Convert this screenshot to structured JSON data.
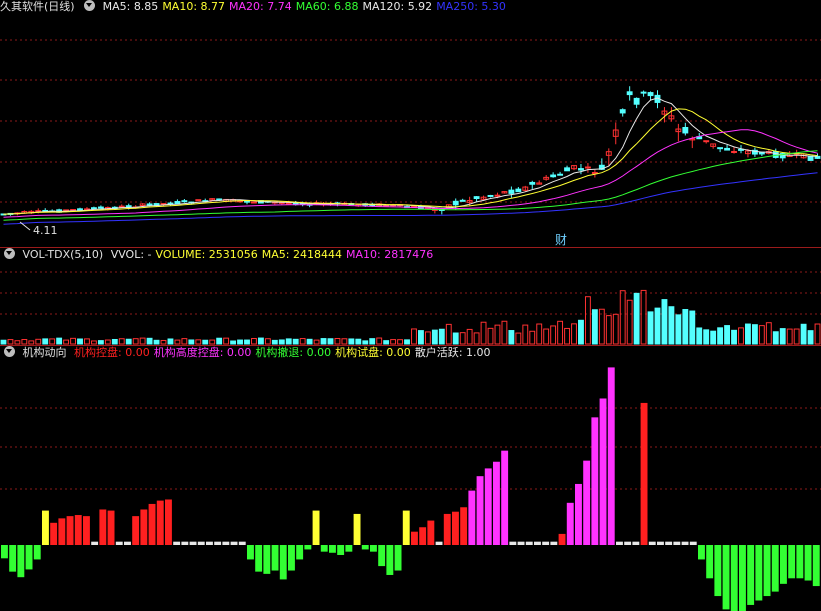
{
  "main_panel": {
    "title": "久其软件(日线)",
    "ma": [
      {
        "label": "MA5: ",
        "value": "8.85",
        "color": "#e8e8e8"
      },
      {
        "label": "MA10: ",
        "value": "8.77",
        "color": "#ffff33"
      },
      {
        "label": "MA20: ",
        "value": "7.74",
        "color": "#ff33ff"
      },
      {
        "label": "MA60: ",
        "value": "6.88",
        "color": "#33ff33"
      },
      {
        "label": "MA120: ",
        "value": "5.92",
        "color": "#e8e8e8"
      },
      {
        "label": "MA250: ",
        "value": "5.30",
        "color": "#3333ff"
      }
    ],
    "low_label": "4.11",
    "event_marker": "财"
  },
  "volume_panel": {
    "title": "VOL-TDX(5,10)",
    "items": [
      {
        "text": "VVOL: -",
        "color": "#e8e8e8"
      },
      {
        "text": "VOLUME: 2531056",
        "color": "#ffff33"
      },
      {
        "text": "MA5: 2418444",
        "color": "#ffff33"
      },
      {
        "text": "MA10: 2817476",
        "color": "#ff33ff"
      }
    ]
  },
  "indicator_panel": {
    "title": "机构动向",
    "items": [
      {
        "label": "机构控盘",
        "value": ": 0.00",
        "color": "#ff2020"
      },
      {
        "label": "机构高度控盘",
        "value": ": 0.00",
        "color": "#ff33ff"
      },
      {
        "label": "机构撤退",
        "value": ": 0.00",
        "color": "#33ff33"
      },
      {
        "label": "机构试盘",
        "value": ": 0.00",
        "color": "#ffff33"
      },
      {
        "label": "散户活跃",
        "value": ": 1.00",
        "color": "#e8e8e8"
      }
    ]
  },
  "colors": {
    "up": "#ff3232",
    "down": "#54ffff",
    "grid": "#8b1a1a"
  },
  "chart_data": {
    "type": "bar",
    "series": [
      {
        "name": "机构控盘",
        "color": "#ff2020"
      },
      {
        "name": "机构高度控盘",
        "color": "#ff33ff"
      },
      {
        "name": "机构撤退",
        "color": "#33ff33"
      },
      {
        "name": "机构试盘",
        "color": "#ffff33"
      },
      {
        "name": "散户活跃",
        "color": "#e8e8e8"
      }
    ],
    "bars": [
      {
        "s": 2,
        "v": -1.2
      },
      {
        "s": 2,
        "v": -2.4
      },
      {
        "s": 2,
        "v": -2.9
      },
      {
        "s": 2,
        "v": -2.2
      },
      {
        "s": 2,
        "v": -1.3
      },
      {
        "s": 3,
        "v": 3.1
      },
      {
        "s": 0,
        "v": 2.0
      },
      {
        "s": 0,
        "v": 2.4
      },
      {
        "s": 0,
        "v": 2.6
      },
      {
        "s": 0,
        "v": 2.7
      },
      {
        "s": 0,
        "v": 2.6
      },
      {
        "s": 4,
        "v": 0.3
      },
      {
        "s": 0,
        "v": 3.2
      },
      {
        "s": 0,
        "v": 3.1
      },
      {
        "s": 4,
        "v": 0.3
      },
      {
        "s": 4,
        "v": 0.3
      },
      {
        "s": 0,
        "v": 2.6
      },
      {
        "s": 0,
        "v": 3.2
      },
      {
        "s": 0,
        "v": 3.7
      },
      {
        "s": 0,
        "v": 4.0
      },
      {
        "s": 0,
        "v": 4.1
      },
      {
        "s": 4,
        "v": 0.3
      },
      {
        "s": 4,
        "v": 0.3
      },
      {
        "s": 4,
        "v": 0.3
      },
      {
        "s": 4,
        "v": 0.3
      },
      {
        "s": 4,
        "v": 0.3
      },
      {
        "s": 4,
        "v": 0.3
      },
      {
        "s": 4,
        "v": 0.3
      },
      {
        "s": 4,
        "v": 0.3
      },
      {
        "s": 4,
        "v": 0.3
      },
      {
        "s": 2,
        "v": -1.3
      },
      {
        "s": 2,
        "v": -2.4
      },
      {
        "s": 2,
        "v": -2.6
      },
      {
        "s": 2,
        "v": -2.3
      },
      {
        "s": 2,
        "v": -3.1
      },
      {
        "s": 2,
        "v": -2.3
      },
      {
        "s": 2,
        "v": -1.3
      },
      {
        "s": 2,
        "v": -0.4
      },
      {
        "s": 3,
        "v": 3.1
      },
      {
        "s": 2,
        "v": -0.6
      },
      {
        "s": 2,
        "v": -0.7
      },
      {
        "s": 2,
        "v": -0.9
      },
      {
        "s": 2,
        "v": -0.6
      },
      {
        "s": 3,
        "v": 2.8
      },
      {
        "s": 2,
        "v": -0.4
      },
      {
        "s": 2,
        "v": -0.6
      },
      {
        "s": 2,
        "v": -1.9
      },
      {
        "s": 2,
        "v": -2.7
      },
      {
        "s": 2,
        "v": -2.3
      },
      {
        "s": 3,
        "v": 3.1
      },
      {
        "s": 0,
        "v": 1.2
      },
      {
        "s": 0,
        "v": 1.6
      },
      {
        "s": 0,
        "v": 2.2
      },
      {
        "s": 4,
        "v": 0.3
      },
      {
        "s": 0,
        "v": 2.8
      },
      {
        "s": 0,
        "v": 3.0
      },
      {
        "s": 0,
        "v": 3.4
      },
      {
        "s": 1,
        "v": 4.9
      },
      {
        "s": 1,
        "v": 6.2
      },
      {
        "s": 1,
        "v": 6.9
      },
      {
        "s": 1,
        "v": 7.5
      },
      {
        "s": 1,
        "v": 8.5
      },
      {
        "s": 4,
        "v": 0.3
      },
      {
        "s": 4,
        "v": 0.3
      },
      {
        "s": 4,
        "v": 0.3
      },
      {
        "s": 4,
        "v": 0.3
      },
      {
        "s": 4,
        "v": 0.3
      },
      {
        "s": 4,
        "v": 0.3
      },
      {
        "s": 0,
        "v": 1.0
      },
      {
        "s": 1,
        "v": 3.8
      },
      {
        "s": 1,
        "v": 5.5
      },
      {
        "s": 1,
        "v": 7.6
      },
      {
        "s": 1,
        "v": 11.5
      },
      {
        "s": 1,
        "v": 13.2
      },
      {
        "s": 1,
        "v": 16.0
      },
      {
        "s": 4,
        "v": 0.3
      },
      {
        "s": 4,
        "v": 0.3
      },
      {
        "s": 4,
        "v": 0.3
      },
      {
        "s": 0,
        "v": 12.8
      },
      {
        "s": 4,
        "v": 0.3
      },
      {
        "s": 4,
        "v": 0.3
      },
      {
        "s": 4,
        "v": 0.3
      },
      {
        "s": 4,
        "v": 0.3
      },
      {
        "s": 4,
        "v": 0.3
      },
      {
        "s": 4,
        "v": 0.3
      },
      {
        "s": 2,
        "v": -1.3
      },
      {
        "s": 2,
        "v": -3.0
      },
      {
        "s": 2,
        "v": -4.6
      },
      {
        "s": 2,
        "v": -5.8
      },
      {
        "s": 2,
        "v": -6.2
      },
      {
        "s": 2,
        "v": -6.0
      },
      {
        "s": 2,
        "v": -5.4
      },
      {
        "s": 2,
        "v": -5.0
      },
      {
        "s": 2,
        "v": -4.6
      },
      {
        "s": 2,
        "v": -4.2
      },
      {
        "s": 2,
        "v": -3.5
      },
      {
        "s": 2,
        "v": -3.0
      },
      {
        "s": 2,
        "v": -3.0
      },
      {
        "s": 2,
        "v": -3.2
      },
      {
        "s": 2,
        "v": -3.7
      }
    ]
  }
}
